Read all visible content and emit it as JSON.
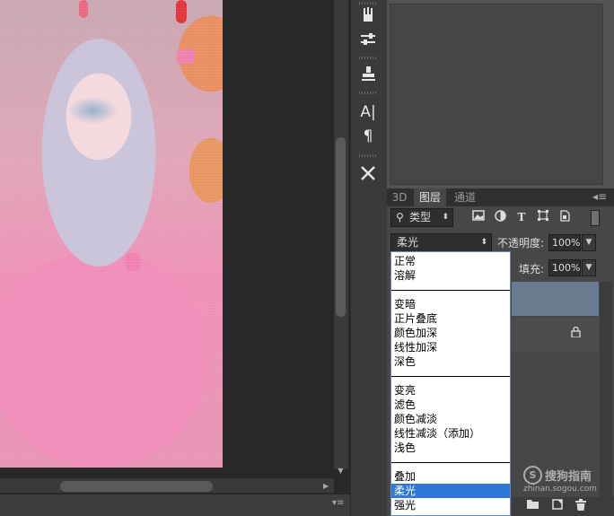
{
  "colors": {
    "ui_dark": "#282828",
    "panel_bg": "#474747",
    "selected_layer": "#6a7a90",
    "list_selection": "#3078d7"
  },
  "tools": [
    "brush-tools-icon",
    "adjustments-icon",
    "clone-stamp-icon",
    "character-icon",
    "paragraph-icon",
    "tools-preset-icon"
  ],
  "tool_glyphs": {
    "text": "A|",
    "paragraph": "¶"
  },
  "layers_panel": {
    "tabs": [
      "3D",
      "图层",
      "通道"
    ],
    "active_tab": "图层",
    "filter_kind": "类型",
    "blend_mode": "柔光",
    "opacity_label": "不透明度:",
    "opacity_value": "100%",
    "fill_label": "填充:",
    "fill_value": "100%"
  },
  "blend_modes_list": {
    "group1": [
      "正常",
      "溶解"
    ],
    "group2": [
      "变暗",
      "正片叠底",
      "颜色加深",
      "线性加深",
      "深色"
    ],
    "group3": [
      "变亮",
      "滤色",
      "颜色减淡",
      "线性减淡（添加）",
      "浅色"
    ],
    "group4": [
      "叠加",
      "柔光",
      "强光"
    ],
    "selected": "柔光"
  },
  "watermark": {
    "logo": "S",
    "text": "搜狗指南",
    "url": "zhinan.sogou.com"
  }
}
